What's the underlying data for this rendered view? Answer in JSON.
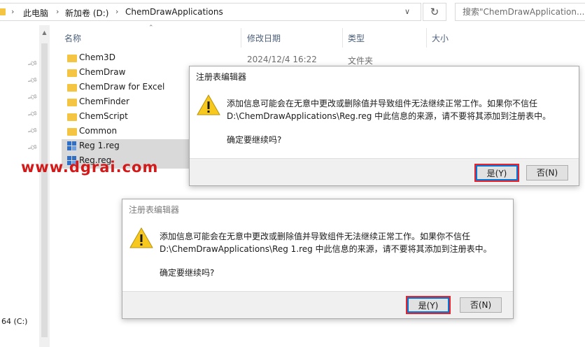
{
  "explorer": {
    "breadcrumb": [
      "此电脑",
      "新加卷 (D:)",
      "ChemDrawApplications"
    ],
    "search_placeholder": "搜索\"ChemDrawApplication...",
    "columns": [
      "名称",
      "修改日期",
      "类型",
      "大小"
    ],
    "files": [
      {
        "name": "Chem3D",
        "kind": "folder",
        "date": "2024/12/4 16:22",
        "type": "文件夹"
      },
      {
        "name": "ChemDraw",
        "kind": "folder"
      },
      {
        "name": "ChemDraw for Excel",
        "kind": "folder"
      },
      {
        "name": "ChemFinder",
        "kind": "folder"
      },
      {
        "name": "ChemScript",
        "kind": "folder"
      },
      {
        "name": "Common",
        "kind": "folder"
      },
      {
        "name": "Reg 1.reg",
        "kind": "reg"
      },
      {
        "name": "Reg.reg",
        "kind": "reg"
      }
    ],
    "drive_label": "64 (C:)"
  },
  "watermark": "www.dgrai.com",
  "dialog1": {
    "title": "注册表编辑器",
    "line1": "添加信息可能会在无意中更改或删除值并导致组件无法继续正常工作。如果你不信任",
    "line2": "D:\\ChemDrawApplications\\Reg.reg 中此信息的来源，请不要将其添加到注册表中。",
    "question": "确定要继续吗?",
    "yes_label": "是(Y)",
    "no_label": "否(N)"
  },
  "dialog2": {
    "title": "注册表编辑器",
    "line1": "添加信息可能会在无意中更改或删除值并导致组件无法继续正常工作。如果你不信任",
    "line2": "D:\\ChemDrawApplications\\Reg 1.reg 中此信息的来源，请不要将其添加到注册表中。",
    "question": "确定要继续吗?",
    "yes_label": "是(Y)",
    "no_label": "否(N)"
  },
  "colors": {
    "accent": "#0078d7",
    "highlight_box": "#e8232b",
    "folder": "#f4c542",
    "watermark": "#d21a1a"
  }
}
